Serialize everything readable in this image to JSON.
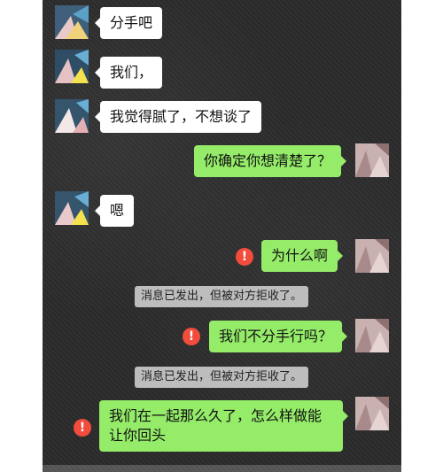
{
  "colors": {
    "chat_bg": "#2a2a2a",
    "bubble_left": "#ffffff",
    "bubble_right": "#95ec69",
    "error_icon": "#f24c3d",
    "system_notice_bg": "#bdbdbd"
  },
  "messages": [
    {
      "side": "left",
      "text": "分手吧"
    },
    {
      "side": "left",
      "text": "我们，"
    },
    {
      "side": "left",
      "text": "我觉得腻了，不想谈了"
    },
    {
      "side": "right",
      "text": "你确定你想清楚了？"
    },
    {
      "side": "left",
      "text": "嗯"
    },
    {
      "side": "right",
      "text": "为什么啊",
      "status": "failed"
    },
    {
      "side": "right",
      "text": "我们不分手行吗？",
      "status": "failed"
    },
    {
      "side": "right",
      "text": "我们在一起那么久了，怎么样做能让你回头",
      "status": "failed"
    }
  ],
  "system_notices": [
    {
      "text": "消息已发出，但被对方拒收了。"
    },
    {
      "text": "消息已发出，但被对方拒收了。"
    }
  ],
  "icons": {
    "error": "!"
  }
}
